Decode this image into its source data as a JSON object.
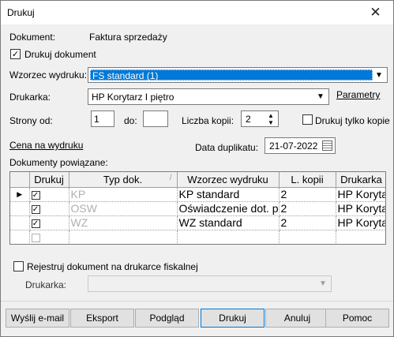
{
  "window": {
    "title": "Drukuj"
  },
  "form": {
    "dokument_label": "Dokument:",
    "dokument_value": "Faktura sprzedaży",
    "drukuj_dokument_label": "Drukuj dokument",
    "drukuj_dokument_checked": true,
    "wzorzec_label": "Wzorzec wydruku:",
    "wzorzec_value": "FS standard (1)",
    "drukarka_label": "Drukarka:",
    "drukarka_value": "HP Korytarz I piętro",
    "parametry_link": "Parametry",
    "strony_od_label": "Strony od:",
    "strony_od_value": "1",
    "do_label": "do:",
    "do_value": "",
    "liczba_kopii_label": "Liczba kopii:",
    "liczba_kopii_value": "2",
    "tylko_kopie_label": "Drukuj tylko kopie",
    "tylko_kopie_checked": false,
    "cena_link": "Cena na wydruku",
    "data_duplikatu_label": "Data duplikatu:",
    "data_duplikatu_value": "21-07-2022",
    "dokumenty_powiazane_label": "Dokumenty powiązane:"
  },
  "grid": {
    "columns": [
      "Drukuj",
      "Typ dok.",
      "Wzorzec wydruku",
      "L. kopii",
      "Drukarka"
    ],
    "rows": [
      {
        "drukuj": true,
        "typ": "KP",
        "wzorzec": "KP standard",
        "kopii": "2",
        "drukarka": "HP Korytar"
      },
      {
        "drukuj": true,
        "typ": "OSW",
        "wzorzec": "Oświadczenie dot. po",
        "kopii": "2",
        "drukarka": "HP Korytar"
      },
      {
        "drukuj": true,
        "typ": "WZ",
        "wzorzec": "WZ standard",
        "kopii": "2",
        "drukarka": "HP Korytar"
      }
    ]
  },
  "fiscal": {
    "rejestruj_label": "Rejestruj dokument na drukarce fiskalnej",
    "rejestruj_checked": false,
    "drukarka_label": "Drukarka:",
    "drukarka_value": ""
  },
  "buttons": {
    "email": "Wyślij e-mail",
    "eksport": "Eksport",
    "podglad": "Podgląd",
    "drukuj": "Drukuj",
    "anuluj": "Anuluj",
    "pomoc": "Pomoc"
  },
  "colors": {
    "selection": "#0078d7",
    "window_bg": "#f0f0f0"
  }
}
